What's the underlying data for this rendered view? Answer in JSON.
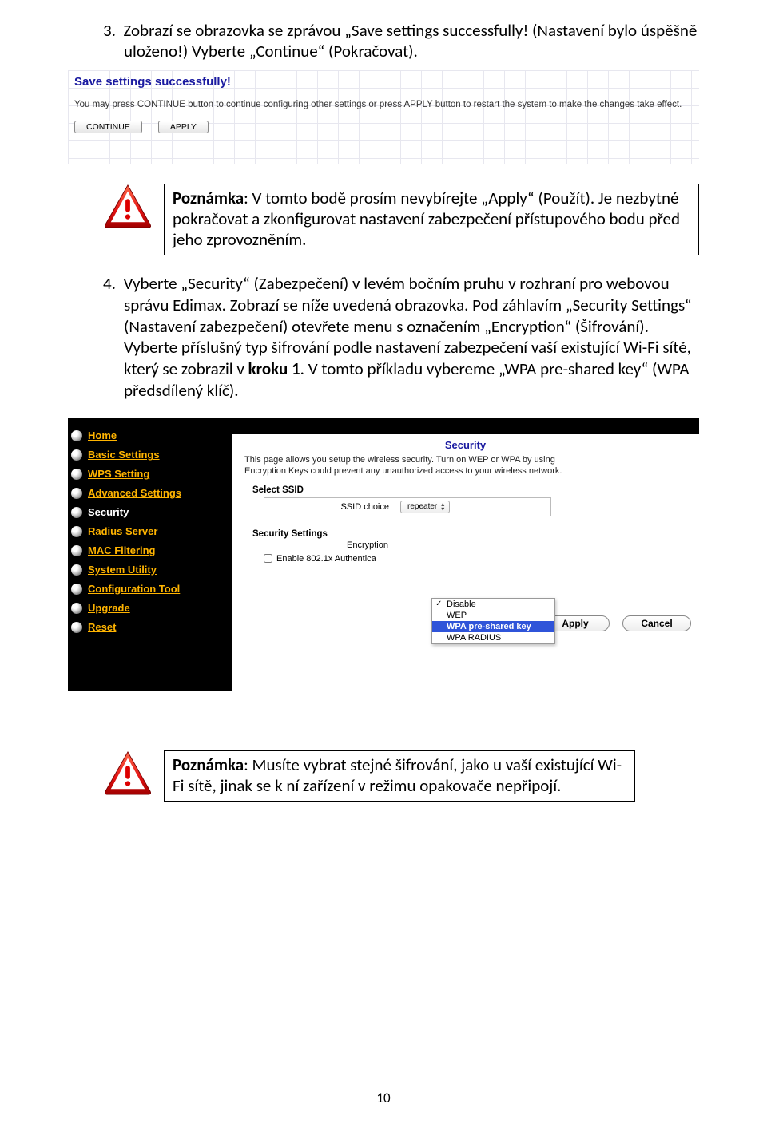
{
  "step3": "3.  Zobrazí se obrazovka se zprávou „Save settings successfully! (Nastavení bylo úspěšně uloženo!) Vyberte „Continue“ (Pokračovat).",
  "save_panel": {
    "title": "Save settings successfully!",
    "text": "You may press CONTINUE button to continue configuring other settings or press APPLY button to restart the system to make the changes take effect.",
    "continue": "CONTINUE",
    "apply": "APPLY"
  },
  "note1": {
    "bold": "Poznámka",
    "text": ": V tomto bodě prosím nevybírejte „Apply“ (Použít). Je nezbytné pokračovat a zkonfigurovat nastavení zabezpečení přístupového bodu před jeho zprovozněním."
  },
  "step4_a": "4.  Vyberte „Security“ (Zabezpečení) v levém bočním pruhu v rozhraní pro webovou správu Edimax. Zobrazí se níže uvedená obrazovka. Pod záhlavím „Security Settings“ (Nastavení zabezpečení) otevřete menu s označením „Encryption“ (Šifrování).",
  "step4_b": "Vyberte příslušný typ šifrování podle nastavení zabezpečení vaší existující Wi-Fi sítě, který se zobrazil v ",
  "step4_bold": "kroku 1",
  "step4_c": ". V tomto příkladu vybereme „WPA pre-shared key“ (WPA předsdílený klíč).",
  "nav": {
    "home": "Home",
    "basic": "Basic Settings",
    "wps": "WPS Setting",
    "advanced": "Advanced Settings",
    "security": "Security",
    "radius": "Radius Server",
    "mac": "MAC Filtering",
    "system": "System Utility",
    "config": "Configuration Tool",
    "upgrade": "Upgrade",
    "reset": "Reset"
  },
  "sec": {
    "title": "Security",
    "desc": "This page allows you setup the wireless security. Turn on WEP or WPA by using Encryption Keys could prevent any unauthorized access to your wireless network.",
    "select_ssid": "Select SSID",
    "ssid_choice": "SSID choice",
    "ssid_value": "repeater",
    "settings": "Security Settings",
    "encryption": "Encryption",
    "enable_8021x": "Enable 802.1x Authentica",
    "apply": "Apply",
    "cancel": "Cancel"
  },
  "dropdown": {
    "disable": "Disable",
    "wep": "WEP",
    "wpa_psk": "WPA pre-shared key",
    "wpa_radius": "WPA RADIUS"
  },
  "note2": {
    "bold": "Poznámka",
    "text": ": Musíte vybrat stejné šifrování, jako u vaší existující Wi-Fi sítě, jinak se k ní zařízení v režimu opakovače nepřipojí."
  },
  "pagenum": "10"
}
